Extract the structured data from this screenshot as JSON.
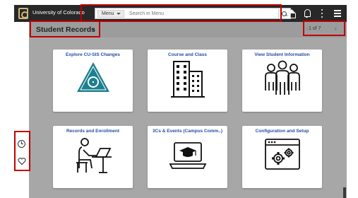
{
  "header": {
    "brand": "University of Colorado",
    "menu_label": "Menu",
    "search_placeholder": "Search in Menu"
  },
  "page": {
    "title": "Student Records",
    "pager": "1 of 7",
    "prev": "‹",
    "next": "›"
  },
  "tiles": [
    {
      "title": "Explore CU-SIS Changes",
      "icon": "compass-triangle-icon"
    },
    {
      "title": "Course and Class",
      "icon": "buildings-icon"
    },
    {
      "title": "View Student Information",
      "icon": "people-group-icon"
    },
    {
      "title": "Records and Enrollment",
      "icon": "student-laptop-icon"
    },
    {
      "title": "3Cs & Events (Campus Comm..)",
      "icon": "laptop-graduation-cap-icon"
    },
    {
      "title": "Configuration and Setup",
      "icon": "window-gears-icon"
    }
  ],
  "colors": {
    "header_bg": "#282828",
    "content_bg": "#a7a7a7",
    "tile_title": "#1f4fa0",
    "highlight": "#c00000",
    "teal": "#1c7f8f"
  }
}
